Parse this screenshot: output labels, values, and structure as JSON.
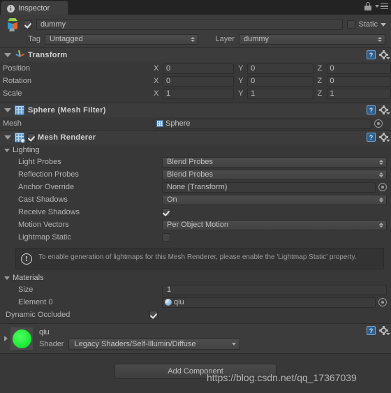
{
  "window": {
    "tab_label": "Inspector",
    "tab_icon": "info-icon",
    "lock_icon": "lock-icon",
    "menu_icon": "hamburger-menu-icon"
  },
  "gameobject": {
    "icon": "gameobject-cube-icon",
    "enabled": true,
    "name": "dummy",
    "static_label": "Static",
    "static_checked": false,
    "tag_label": "Tag",
    "tag_value": "Untagged",
    "layer_label": "Layer",
    "layer_value": "dummy"
  },
  "transform": {
    "title": "Transform",
    "icon": "transform-axes-icon",
    "expanded": true,
    "rows": [
      {
        "label": "Position",
        "x": "0",
        "y": "0",
        "z": "0"
      },
      {
        "label": "Rotation",
        "x": "0",
        "y": "0",
        "z": "0"
      },
      {
        "label": "Scale",
        "x": "1",
        "y": "1",
        "z": "1"
      }
    ],
    "axis_labels": {
      "x": "X",
      "y": "Y",
      "z": "Z"
    }
  },
  "mesh_filter": {
    "title": "Sphere (Mesh Filter)",
    "icon": "mesh-filter-icon",
    "expanded": true,
    "mesh_label": "Mesh",
    "mesh_value": "Sphere"
  },
  "mesh_renderer": {
    "title": "Mesh Renderer",
    "icon": "mesh-renderer-icon",
    "enabled": true,
    "expanded": true,
    "lighting": {
      "title": "Lighting",
      "expanded": true,
      "light_probes_label": "Light Probes",
      "light_probes_value": "Blend Probes",
      "reflection_probes_label": "Reflection Probes",
      "reflection_probes_value": "Blend Probes",
      "anchor_override_label": "Anchor Override",
      "anchor_override_value": "None (Transform)",
      "cast_shadows_label": "Cast Shadows",
      "cast_shadows_value": "On",
      "receive_shadows_label": "Receive Shadows",
      "receive_shadows_checked": true,
      "motion_vectors_label": "Motion Vectors",
      "motion_vectors_value": "Per Object Motion",
      "lightmap_static_label": "Lightmap Static",
      "lightmap_static_checked": false
    },
    "help_box": {
      "icon": "warning-icon",
      "text": "To enable generation of lightmaps for this Mesh Renderer, please enable the 'Lightmap Static' property."
    },
    "materials": {
      "title": "Materials",
      "expanded": true,
      "size_label": "Size",
      "size_value": "1",
      "element_label": "Element 0",
      "element_value": "qiu"
    },
    "dynamic_occluded_label": "Dynamic Occluded",
    "dynamic_occluded_checked": true
  },
  "material": {
    "name": "qiu",
    "preview_color": "#22ee3a",
    "shader_label": "Shader",
    "shader_value": "Legacy Shaders/Self-Illumin/Diffuse",
    "expanded": false
  },
  "footer": {
    "add_component_label": "Add Component"
  },
  "watermark": {
    "text": "https://blog.csdn.net/qq_17367039"
  },
  "icons": {
    "help": "?",
    "gear": "gear-icon",
    "warning": "!"
  }
}
